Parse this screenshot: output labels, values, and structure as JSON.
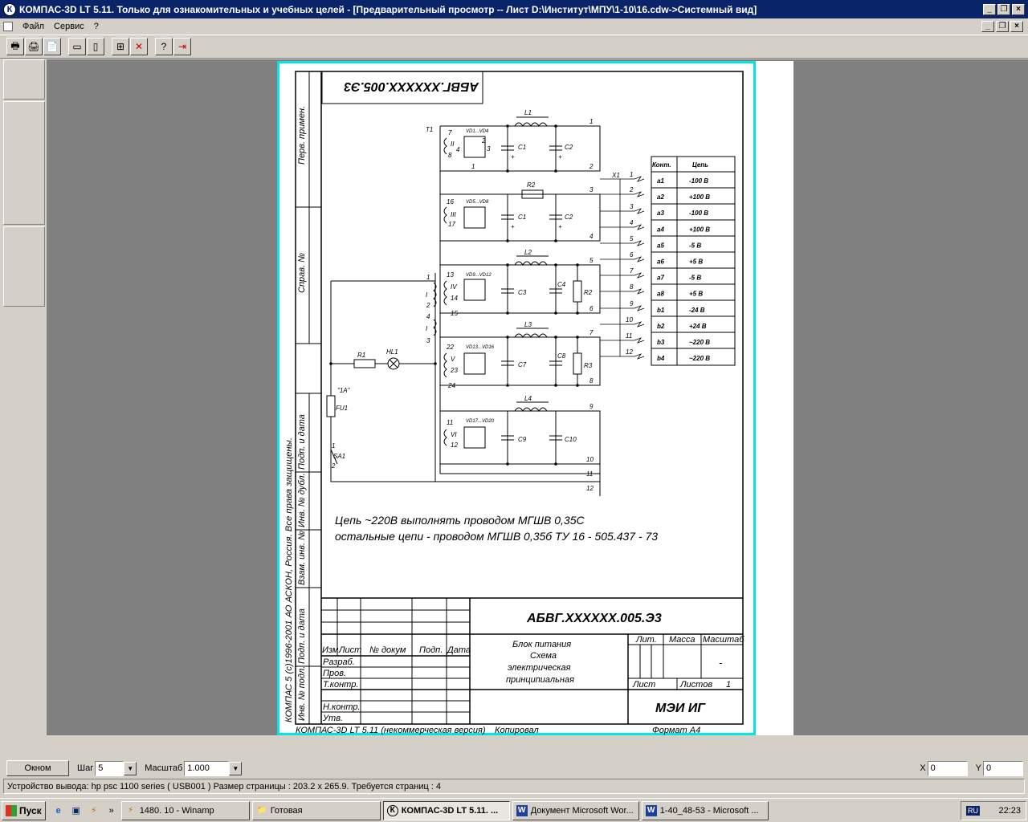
{
  "window": {
    "app_glyph": "К",
    "title": "КОМПАС-3D LT 5.11. Только для ознакомительных и учебных целей - [Предварительный просмотр -- Лист D:\\Институт\\МПУ\\1-10\\16.cdw->Системный вид]",
    "controls": {
      "minimize": "_",
      "restore": "❐",
      "close": "×"
    }
  },
  "menu": {
    "items": [
      "Файл",
      "Сервис",
      "?"
    ]
  },
  "toolbar": {
    "icons": [
      "print-icon",
      "print-setup-icon",
      "page-setup-icon",
      "fit-page-icon",
      "fit-sheet-icon",
      "grid-icon",
      "disable-icon",
      "help-icon",
      "exit-preview-icon"
    ],
    "glyphs": [
      "🖶",
      "🖨",
      "📄",
      "▭",
      "▯",
      "⊞",
      "✕",
      "?",
      "⇥"
    ]
  },
  "drawing": {
    "mirrored_code": "АБВГ.XXXXXX.005.Э3",
    "side_column": [
      "Перв. примен.",
      "Справ. №",
      "Подп. и дата",
      "Инв. № дубл.",
      "Взам. инв. №",
      "Подп. и дата",
      "Инв. № подл."
    ],
    "copyright": "КОМПАС 5 (с)1996-2001 АО АСКОН, Россия. Все права защищены.",
    "note_line1": "Цепь ~220В выполнять проводом МГШВ 0,35С",
    "note_line2": "остальные цепи - проводом МГШВ 0,35б ТУ 16 - 505.437 - 73",
    "doc_code": "АБВГ.XXXXXX.005.Э3",
    "desc": [
      "Блок питания",
      "Схема",
      "электрическая",
      "принципиальная"
    ],
    "tb_headers": [
      "Изм",
      "Лист",
      "№ докум",
      "Подп.",
      "Дата"
    ],
    "tb_rows": [
      "Разраб.",
      "Пров.",
      "Т.контр.",
      "Н.контр.",
      "Утв."
    ],
    "lit": "Лит.",
    "mass": "Масса",
    "scale_hdr": "Масштаб",
    "scale_val": "-",
    "sheet": "Лист",
    "sheets": "Листов",
    "sheets_val": "1",
    "org": "МЭИ ИГ",
    "footer_left": "КОМПАС-3D LT 5.11 (некоммерческая версия)",
    "footer_mid": "Копировал",
    "footer_right": "Формат   А4",
    "table_head": [
      "Конт.",
      "Цепь"
    ],
    "table_rows": [
      [
        "а1",
        "-100 В"
      ],
      [
        "а2",
        "+100 В"
      ],
      [
        "а3",
        "-100 В"
      ],
      [
        "а4",
        "+100 В"
      ],
      [
        "а5",
        "-5 В"
      ],
      [
        "а6",
        "+5 В"
      ],
      [
        "а7",
        "-5 В"
      ],
      [
        "а8",
        "+5 В"
      ],
      [
        "b1",
        "-24 В"
      ],
      [
        "b2",
        "+24 В"
      ],
      [
        "b3",
        "~220 В"
      ],
      [
        "b4",
        "~220 В"
      ]
    ],
    "labels": {
      "t1": "T1",
      "x1": "X1",
      "l1": "L1",
      "l2": "L2",
      "l3": "L3",
      "l4": "L4",
      "r1": "R1",
      "r2a": "R2",
      "r2b": "R2",
      "r3": "R3",
      "hl1": "HL1",
      "fu1": "FU1",
      "sa1": "SA1",
      "fuse_rating": "\"1А\"",
      "c1a": "C1",
      "c2a": "C2",
      "c1b": "C1",
      "c2b": "C2",
      "c3": "C3",
      "c4": "C4",
      "c7": "C7",
      "c8": "C8",
      "c9": "C9",
      "c10": "C10",
      "d1": "VD1...VD4",
      "d2": "VD5...VD8",
      "d3": "VD9...VD12",
      "d4": "VD13...VD16",
      "d5": "VD17...VD20",
      "w2": "II",
      "w3": "III",
      "w4": "IV",
      "w5": "V",
      "w6": "VI",
      "w1a": "I",
      "w1b": "I",
      "p7": "7",
      "p8": "8",
      "p4": "4",
      "p1": "1",
      "p2": "2",
      "p3": "3",
      "p16": "16",
      "p17": "17",
      "p13": "13",
      "p14": "14",
      "p15": "15",
      "p22": "22",
      "p23": "23",
      "p24": "24",
      "p11": "11",
      "p12": "12",
      "pr1": "1",
      "pr2": "2",
      "pr4": "4",
      "pr3": "3",
      "sa1n": "1",
      "sa2n": "2",
      "plus1": "+",
      "plus2": "+",
      "plus3": "+",
      "plus4": "+",
      "o1": "1",
      "o2": "2",
      "o3": "3",
      "o4": "4",
      "o5": "5",
      "o6": "6",
      "o7": "7",
      "o8": "8",
      "o9": "9",
      "o10": "10",
      "o11": "11",
      "o12": "12",
      "x1_1": "1",
      "x1_2": "2",
      "x1_3": "3",
      "x1_4": "4",
      "x1_5": "5",
      "x1_6": "6",
      "x1_7": "7",
      "x1_8": "8",
      "x1_9": "9",
      "x1_10": "10",
      "x1_11": "11",
      "x1_12": "12"
    }
  },
  "bottombar": {
    "fit_window": "Окном",
    "step_label": "Шаг",
    "step_value": "5",
    "scale_label": "Масштаб",
    "scale_value": "1.000",
    "x_label": "X",
    "x_value": "0",
    "y_label": "Y",
    "y_value": "0"
  },
  "status": {
    "text": "Устройство вывода: hp psc 1100 series ( USB001 )  Размер страницы : 203.2 x 265.9.  Требуется страниц : 4"
  },
  "taskbar": {
    "start": "Пуск",
    "quicklaunch": [
      "ie-icon",
      "desktop-icon",
      "media-icon"
    ],
    "ql_glyphs": [
      "e",
      "▣",
      "⚡"
    ],
    "more": "»",
    "tasks": [
      {
        "icon": "winamp-icon",
        "glyph": "⚡",
        "label": "1480. 10 - Winamp"
      },
      {
        "icon": "folder-icon",
        "glyph": "📁",
        "label": "Готовая"
      },
      {
        "icon": "kompas-icon",
        "glyph": "К",
        "label": "КОМПАС-3D LT 5.11. ..."
      },
      {
        "icon": "word-icon",
        "glyph": "W",
        "label": "Документ Microsoft Wor..."
      },
      {
        "icon": "word-icon",
        "glyph": "W",
        "label": "1-40_48-53 - Microsoft ..."
      }
    ],
    "lang": "RU",
    "clock": "22:23"
  }
}
